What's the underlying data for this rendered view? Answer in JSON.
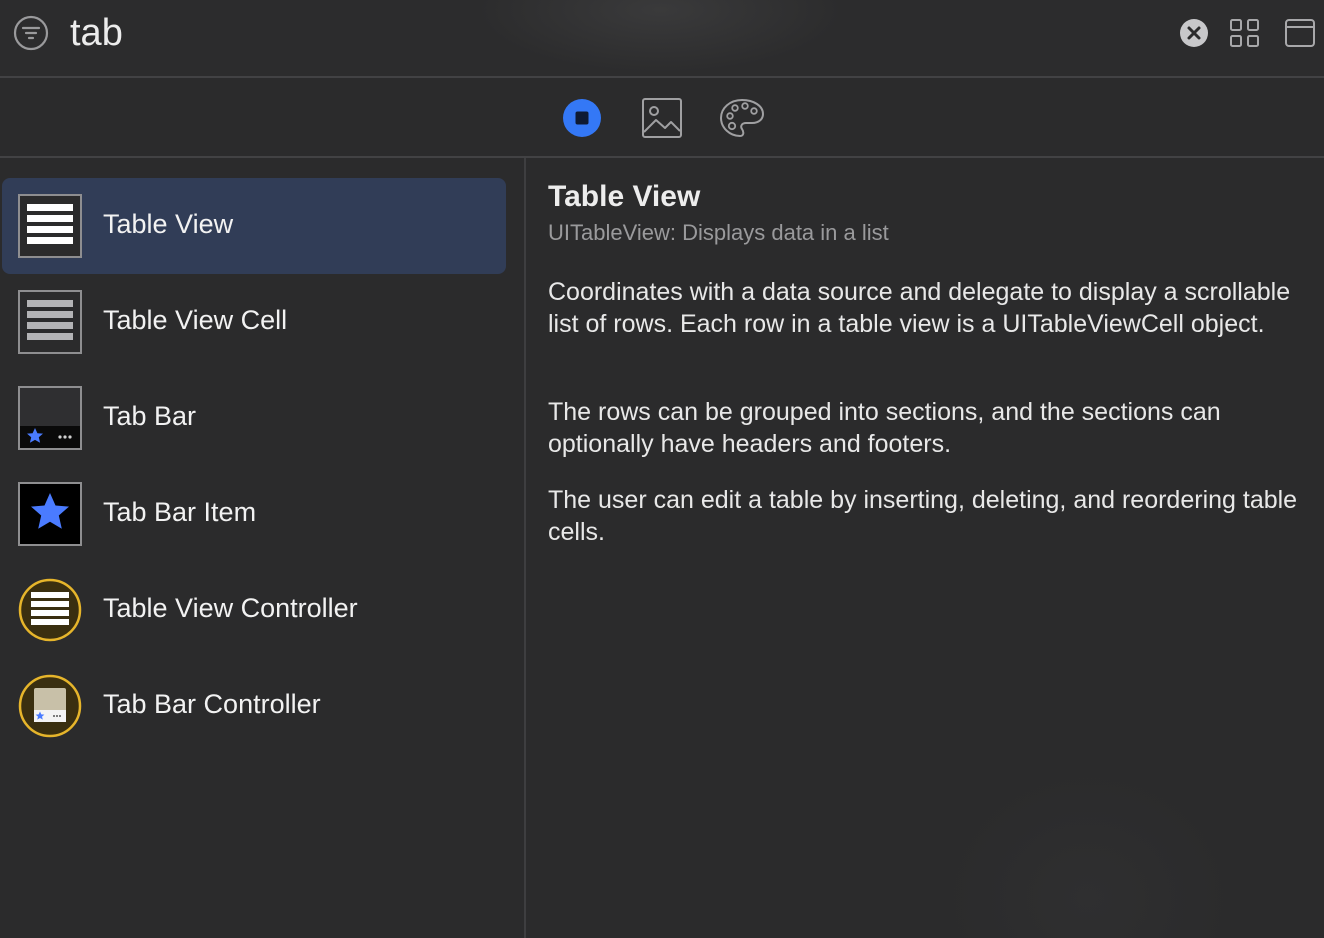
{
  "search": {
    "value": "tab",
    "placeholder": ""
  },
  "icons": {
    "filter": "filter-icon",
    "clear": "clear-icon",
    "grid": "grid-view-icon",
    "window": "window-icon"
  },
  "segments": [
    {
      "name": "objects",
      "icon": "stop-circle-icon",
      "selected": true
    },
    {
      "name": "media",
      "icon": "image-icon",
      "selected": false
    },
    {
      "name": "colors",
      "icon": "palette-icon",
      "selected": false
    }
  ],
  "library": {
    "items": [
      {
        "label": "Table View",
        "icon": "table-view-icon",
        "selected": true
      },
      {
        "label": "Table View Cell",
        "icon": "table-view-cell-icon",
        "selected": false
      },
      {
        "label": "Tab Bar",
        "icon": "tab-bar-icon",
        "selected": false
      },
      {
        "label": "Tab Bar Item",
        "icon": "tab-bar-item-icon",
        "selected": false
      },
      {
        "label": "Table View Controller",
        "icon": "table-view-controller-icon",
        "selected": false
      },
      {
        "label": "Tab Bar Controller",
        "icon": "tab-bar-controller-icon",
        "selected": false
      }
    ]
  },
  "detail": {
    "title": "Table View",
    "subtitle": "UITableView: Displays data in a list",
    "paragraphs": [
      "Coordinates with a data source and delegate to display a scrollable list of rows. Each row in a table view is a UITableViewCell object.",
      "The rows can be grouped into sections, and the sections can optionally have headers and footers.",
      "The user can edit a table by inserting, deleting, and reordering table cells."
    ]
  },
  "colors": {
    "accent": "#3478f6",
    "selection": "#313d57",
    "controller_ring": "#e6b52b",
    "background": "#2b2b2c"
  }
}
